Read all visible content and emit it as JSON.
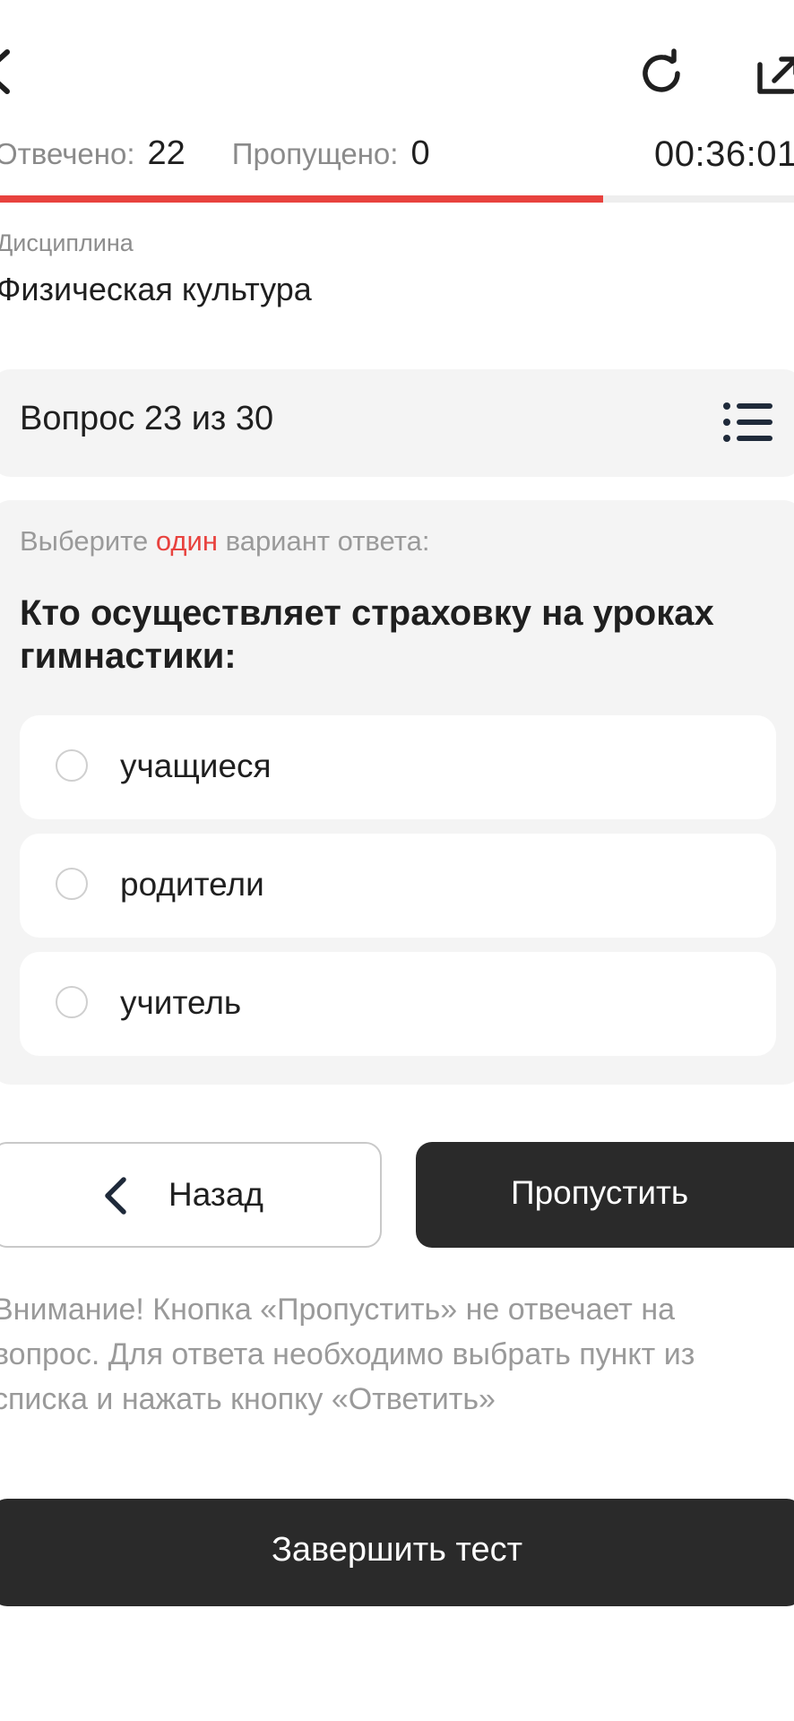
{
  "topbar": {
    "back_icon": "chevron-left-icon",
    "reload_icon": "reload-icon",
    "share_icon": "external-link-icon"
  },
  "stats": {
    "answered_label": "Отвечено:",
    "answered_value": "22",
    "skipped_label": "Пропущено:",
    "skipped_value": "0",
    "timer": "00:36:01"
  },
  "progress": {
    "percent": 76,
    "color": "#e8423e"
  },
  "discipline": {
    "label": "Дисциплина",
    "value": "Физическая культура"
  },
  "question_header": {
    "title": "Вопрос 23 из 30",
    "list_icon": "list-icon"
  },
  "question": {
    "instruction_before": "Выберите ",
    "instruction_accent": "один",
    "instruction_after": " вариант ответа:",
    "text": "Кто осуществляет страховку на уроках гимнастики:",
    "options": [
      {
        "label": "учащиеся"
      },
      {
        "label": "родители"
      },
      {
        "label": "учитель"
      }
    ]
  },
  "nav": {
    "back_label": "Назад",
    "skip_label": "Пропустить"
  },
  "notice": "Внимание! Кнопка «Пропустить» не отвечает на вопрос. Для ответа необходимо выбрать пункт из списка и нажать кнопку «Ответить»",
  "finish_label": "Завершить тест",
  "colors": {
    "accent": "#e8423e",
    "dark_button": "#2a2a2a",
    "card_bg": "#f4f4f4"
  }
}
